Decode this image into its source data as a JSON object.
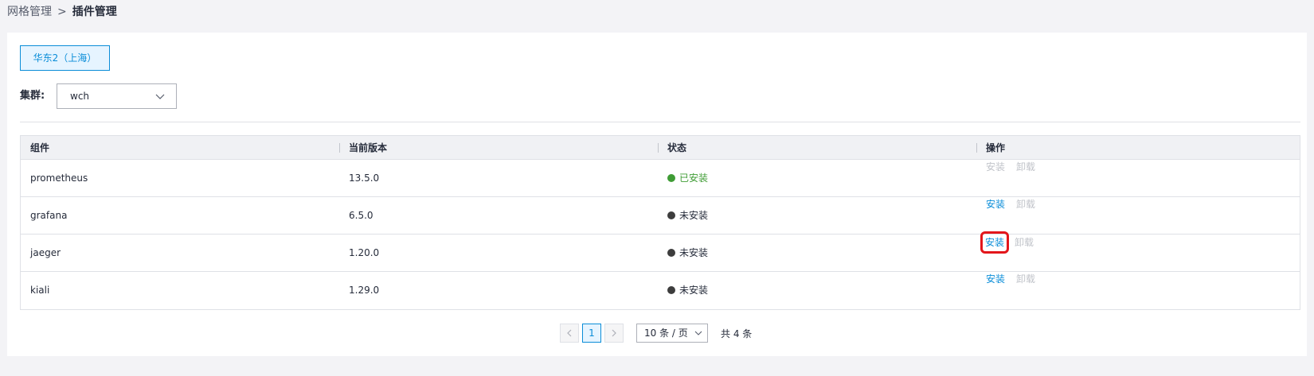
{
  "breadcrumb": {
    "parent": "网格管理",
    "separator": ">",
    "current": "插件管理"
  },
  "region": {
    "label": "华东2（上海）"
  },
  "cluster": {
    "label": "集群:",
    "value": "wch"
  },
  "table": {
    "headers": [
      "组件",
      "当前版本",
      "状态",
      "操作"
    ],
    "rows": [
      {
        "component": "prometheus",
        "version": "13.5.0",
        "status": "已安装",
        "install": "安装",
        "uninstall": "卸载"
      },
      {
        "component": "grafana",
        "version": "6.5.0",
        "status": "未安装",
        "install": "安装",
        "uninstall": "卸载"
      },
      {
        "component": "jaeger",
        "version": "1.20.0",
        "status": "未安装",
        "install": "安装",
        "uninstall": "卸载"
      },
      {
        "component": "kiali",
        "version": "1.29.0",
        "status": "未安装",
        "install": "安装",
        "uninstall": "卸载"
      }
    ]
  },
  "pagination": {
    "current_page": "1",
    "page_size": "10 条 / 页",
    "total": "共 4 条"
  },
  "colors": {
    "accent": "#0a8dd8",
    "installed": "#3f9c35",
    "uninstalled": "#3d3d3d",
    "highlight": "#e3161b"
  },
  "icons": {
    "prev": "chevron-left-icon",
    "next": "chevron-right-icon",
    "dropdown": "chevron-down-icon"
  }
}
